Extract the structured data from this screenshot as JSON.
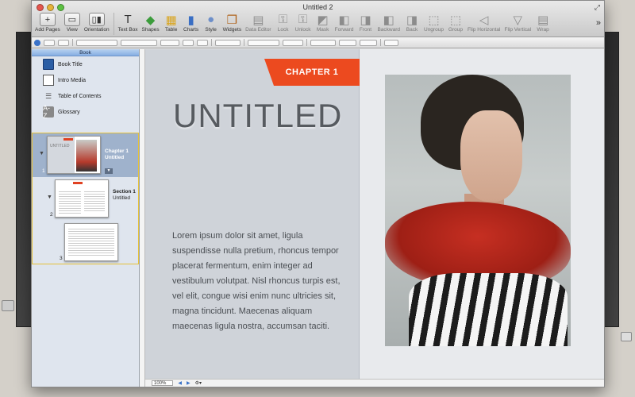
{
  "window": {
    "title": "Untitled 2"
  },
  "toolbar": {
    "items": [
      {
        "label": "Add Pages",
        "icon": "add-pages-icon",
        "glyph": "+"
      },
      {
        "label": "View",
        "icon": "view-icon",
        "glyph": "▭"
      },
      {
        "label": "Orientation",
        "icon": "orientation-icon",
        "glyph": "▯▮"
      },
      {
        "label": "Text Box",
        "icon": "text-box-icon",
        "glyph": "T"
      },
      {
        "label": "Shapes",
        "icon": "shapes-icon",
        "glyph": "◆"
      },
      {
        "label": "Table",
        "icon": "table-icon",
        "glyph": "▦"
      },
      {
        "label": "Charts",
        "icon": "charts-icon",
        "glyph": "▮"
      },
      {
        "label": "Style",
        "icon": "style-icon",
        "glyph": "●"
      },
      {
        "label": "Widgets",
        "icon": "widgets-icon",
        "glyph": "❒"
      },
      {
        "label": "Data Editor",
        "icon": "data-editor-icon",
        "glyph": "▤"
      },
      {
        "label": "Lock",
        "icon": "lock-icon",
        "glyph": "⚿"
      },
      {
        "label": "Unlock",
        "icon": "unlock-icon",
        "glyph": "⚿"
      },
      {
        "label": "Mask",
        "icon": "mask-icon",
        "glyph": "◩"
      },
      {
        "label": "Forward",
        "icon": "forward-icon",
        "glyph": "◧"
      },
      {
        "label": "Front",
        "icon": "front-icon",
        "glyph": "◨"
      },
      {
        "label": "Backward",
        "icon": "backward-icon",
        "glyph": "◧"
      },
      {
        "label": "Back",
        "icon": "back-icon",
        "glyph": "◨"
      },
      {
        "label": "Ungroup",
        "icon": "ungroup-icon",
        "glyph": "⬚"
      },
      {
        "label": "Group",
        "icon": "group-icon",
        "glyph": "⬚"
      },
      {
        "label": "Flip Horizontal",
        "icon": "flip-horizontal-icon",
        "glyph": "◁"
      },
      {
        "label": "Flip Vertical",
        "icon": "flip-vertical-icon",
        "glyph": "▽"
      },
      {
        "label": "Wrap",
        "icon": "wrap-icon",
        "glyph": "▤"
      }
    ],
    "overflow_icon": "chevron-double-right-icon"
  },
  "sidebar": {
    "header": "Book",
    "items": [
      {
        "label": "Book Title",
        "icon": "book-icon"
      },
      {
        "label": "Intro Media",
        "icon": "film-icon"
      },
      {
        "label": "Table of Contents",
        "icon": "list-icon"
      },
      {
        "label": "Glossary",
        "icon": "glossary-icon",
        "glyph": "A-Z"
      }
    ],
    "thumbnails": [
      {
        "number": "1",
        "title": "Chapter 1",
        "subtitle": "Untitled",
        "mini_title": "UNTITLED"
      },
      {
        "number": "2",
        "title": "Section 1",
        "subtitle": "Untitled"
      },
      {
        "number": "3"
      }
    ]
  },
  "document": {
    "chapter_tag": "CHAPTER 1",
    "title": "UNTITLED",
    "body": "Lorem ipsum dolor sit amet, ligula suspendisse nulla pretium, rhoncus tempor placerat fermentum, enim integer ad vestibulum volutpat. Nisl rhoncus turpis est, vel elit, congue wisi enim nunc ultricies sit, magna tincidunt. Maecenas aliquam maecenas ligula nostra, accumsan taciti."
  },
  "status": {
    "zoom": "100%"
  },
  "colors": {
    "accent": "#ec4a1f",
    "selection": "#9fb2cc"
  }
}
